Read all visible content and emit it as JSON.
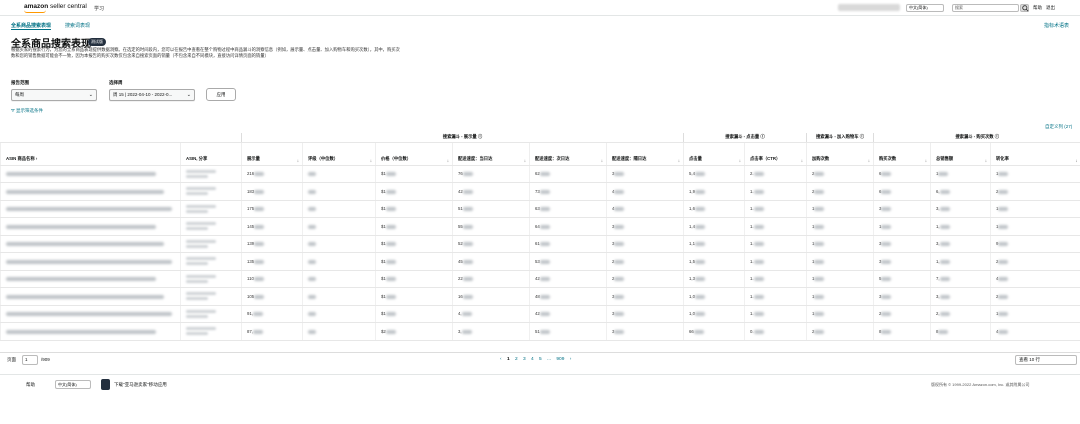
{
  "header": {
    "logo_bold": "amazon",
    "logo_light": " seller central",
    "study": "学习",
    "language": "中文(简体)",
    "search_placeholder": "搜索",
    "help": "帮助",
    "logout": "退出"
  },
  "subnav": {
    "tab_full": "全系商品搜索表现",
    "tab_query": "搜索词表现",
    "tutorial": "指标术语表"
  },
  "page": {
    "title": "全系商品搜索表现",
    "badge": "测试版",
    "description": "根据买家的搜索行为，为您的全系商品表现提供数据洞察。在选定的时间段内，您可以在报告中查看在整个购物过程中商品漏斗的洞察信息（例如，展示量、点击量、加入购物车和购买次数），其中，购买次数和您的销售数据可能会不一致，因为本报告的购买次数仅包含来自搜索页面的销量（不包含来自不同模块，直接访问详情页面的销量）"
  },
  "filters": {
    "range_label": "报告范围",
    "range_value": "每周",
    "week_label": "选择周",
    "week_value": "周 15 | 2022-04-10 - 2022-0...",
    "apply": "应用",
    "show_filters": "显示筛选条件",
    "custom_columns": "自定义列 (27)"
  },
  "table": {
    "groups": [
      "搜索漏斗 - 展示量",
      "搜索漏斗 - 点击量",
      "搜索漏斗 - 加入购物车",
      "搜索漏斗 - 购买次数"
    ],
    "columns": [
      "ASIN 商品名称",
      "ASIN, 分享",
      "展示量",
      "评级（中位数）",
      "价格（中位数）",
      "配送速度：当日达",
      "配送速度：次日达",
      "配送速度：隔日达",
      "点击量",
      "点击率（CTR）",
      "加购次数",
      "购买次数",
      "总销售额",
      "转化率"
    ],
    "rows": [
      {
        "impr": "216",
        "price": "$1",
        "sd": "76",
        "nd": "62",
        "td": "3",
        "clicks": "5,4",
        "ctr": "2.",
        "cart": "2",
        "buy": "6",
        "sales": "1",
        "conv": "1"
      },
      {
        "impr": "183",
        "price": "$1",
        "sd": "42",
        "nd": "73",
        "td": "4",
        "clicks": "1,9",
        "ctr": "1.",
        "cart": "2",
        "buy": "6",
        "sales": "6,",
        "conv": "2"
      },
      {
        "impr": "175",
        "price": "$1",
        "sd": "51",
        "nd": "63",
        "td": "4",
        "clicks": "1,6",
        "ctr": "1.",
        "cart": "1",
        "buy": "3",
        "sales": "3,",
        "conv": "1"
      },
      {
        "impr": "145",
        "price": "$1",
        "sd": "55",
        "nd": "64",
        "td": "3",
        "clicks": "1,4",
        "ctr": "1.",
        "cart": "1",
        "buy": "1",
        "sales": "1,",
        "conv": "1"
      },
      {
        "impr": "139",
        "price": "$1",
        "sd": "52",
        "nd": "61",
        "td": "3",
        "clicks": "1,1",
        "ctr": "1.",
        "cart": "1",
        "buy": "3",
        "sales": "3,",
        "conv": "9"
      },
      {
        "impr": "135",
        "price": "$1",
        "sd": "45",
        "nd": "53",
        "td": "2",
        "clicks": "1,5",
        "ctr": "1.",
        "cart": "1",
        "buy": "3",
        "sales": "1,",
        "conv": "2"
      },
      {
        "impr": "110",
        "price": "$1",
        "sd": "22",
        "nd": "42",
        "td": "2",
        "clicks": "1,3",
        "ctr": "1.",
        "cart": "1",
        "buy": "5",
        "sales": "7,",
        "conv": "4"
      },
      {
        "impr": "105",
        "price": "$1",
        "sd": "16",
        "nd": "48",
        "td": "3",
        "clicks": "1,0",
        "ctr": "1.",
        "cart": "1",
        "buy": "3",
        "sales": "3,",
        "conv": "2"
      },
      {
        "impr": "91,",
        "price": "$1",
        "sd": "4,",
        "nd": "42",
        "td": "3",
        "clicks": "1,0",
        "ctr": "1.",
        "cart": "1",
        "buy": "2",
        "sales": "2,",
        "conv": "1"
      },
      {
        "impr": "87,",
        "price": "$2",
        "sd": "3,",
        "nd": "51",
        "td": "3",
        "clicks": "66",
        "ctr": "0.",
        "cart": "2",
        "buy": "8",
        "sales": "8",
        "conv": "4"
      }
    ]
  },
  "pager": {
    "page_label": "页面",
    "page_value": "1",
    "total": "/909",
    "prev": "‹",
    "pages": [
      "1",
      "2",
      "3",
      "4",
      "5",
      "...",
      "909"
    ],
    "next": "›",
    "page_size": "查看 10 行"
  },
  "footer": {
    "help": "帮助",
    "language": "中文(简体)",
    "app": "下载\"亚马逊卖家\"移动应用",
    "copyright": "版权所有 © 1999-2022 Amazon.com, Inc. 或其附属公司"
  }
}
